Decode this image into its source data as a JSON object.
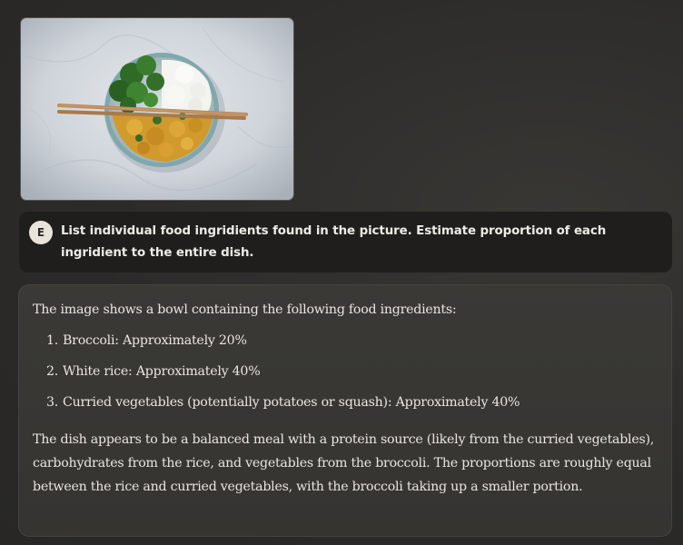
{
  "attachment": {
    "icon": "food-bowl-photo"
  },
  "user_message": {
    "avatar_initial": "E",
    "text": "List individual food ingridients found in the picture. Estimate proportion of each ingridient to the entire dish."
  },
  "response": {
    "intro": "The image shows a bowl containing the following food ingredients:",
    "items": [
      {
        "number": "1.",
        "text": "Broccoli: Approximately 20%"
      },
      {
        "number": "2.",
        "text": "White rice: Approximately 40%"
      },
      {
        "number": "3.",
        "text": "Curried vegetables (potentially potatoes or squash): Approximately 40%"
      }
    ],
    "summary": "The dish appears to be a balanced meal with a protein source (likely from the curried vegetables), carbohydrates from the rice, and vegetables from the broccoli. The proportions are roughly equal between the rice and curried vegetables, with the broccoli taking up a smaller portion."
  }
}
